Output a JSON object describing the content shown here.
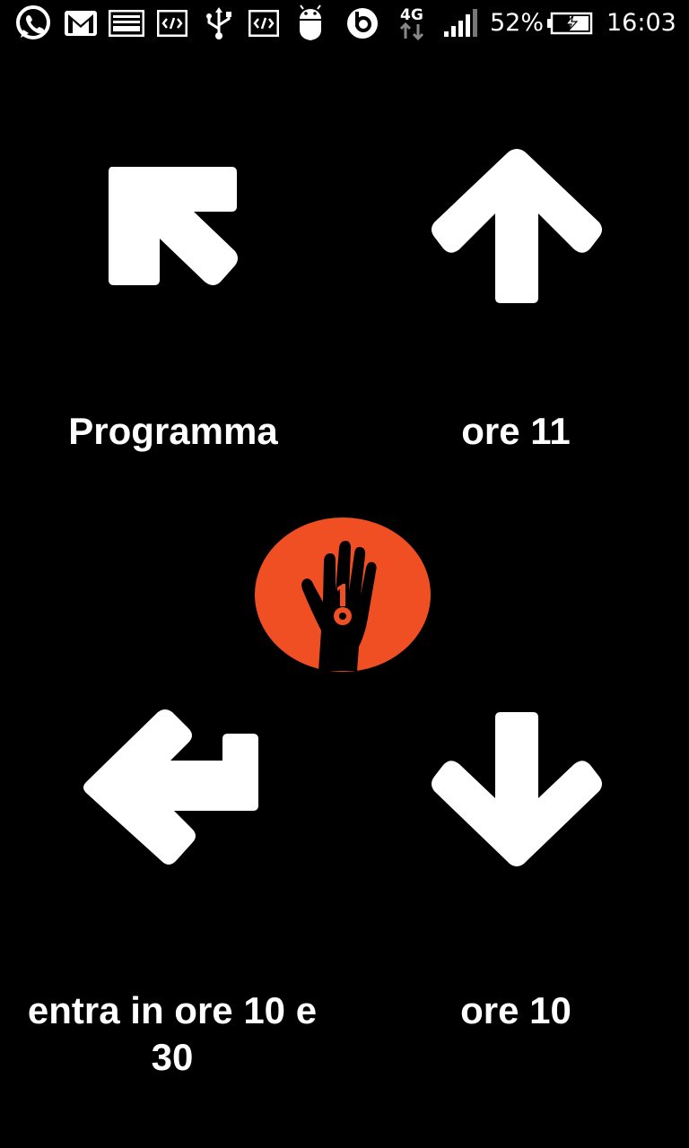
{
  "status_bar": {
    "battery_percent": "52%",
    "time": "16:03",
    "network": "4G",
    "icons": [
      "whatsapp-icon",
      "gmail-icon",
      "image-icon",
      "code-icon",
      "usb-icon",
      "code-icon",
      "android-debug-icon",
      "beats-icon",
      "4g-icon",
      "signal-icon",
      "battery-charging-icon"
    ]
  },
  "controls": [
    {
      "id": "up-left",
      "icon": "arrow-up-left-icon",
      "label": "Programma"
    },
    {
      "id": "up",
      "icon": "arrow-up-icon",
      "label": "ore 11"
    },
    {
      "id": "return-left",
      "icon": "arrow-return-left-icon",
      "label": "entra in ore 10 e 30"
    },
    {
      "id": "down",
      "icon": "arrow-down-icon",
      "label": "ore 10"
    }
  ],
  "center_logo": {
    "icon": "hand-key-logo",
    "color": "#ef4f23"
  }
}
